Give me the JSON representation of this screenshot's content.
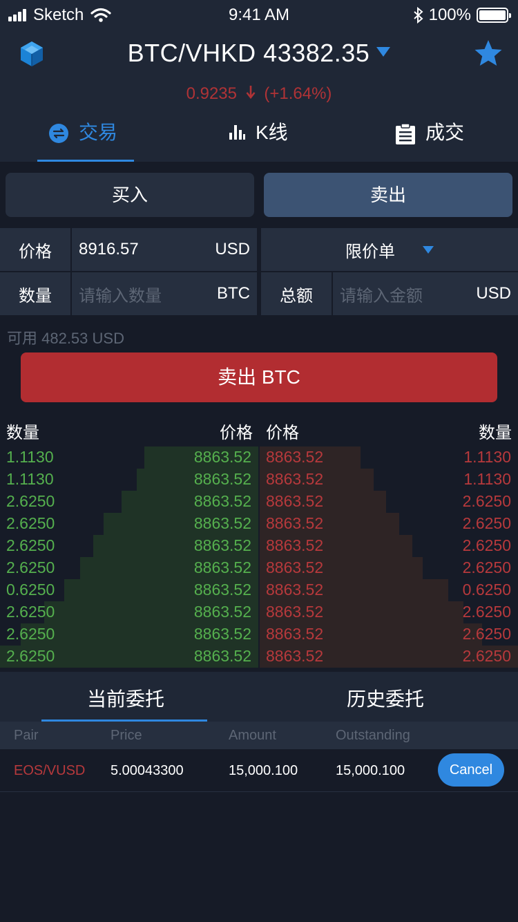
{
  "status_bar": {
    "carrier": "Sketch",
    "time": "9:41 AM",
    "battery": "100%"
  },
  "header": {
    "pair_title": "BTC/VHKD 43382.35",
    "change_value": "0.9235",
    "change_percent": "(+1.64%)",
    "change_color": "#b03336",
    "accent_color": "#2f88e0"
  },
  "tabs": [
    {
      "label": "交易",
      "icon": "exchange-icon"
    },
    {
      "label": "K线",
      "icon": "bar-chart-icon"
    },
    {
      "label": "成交",
      "icon": "clipboard-icon"
    }
  ],
  "trade_toggle": {
    "buy": "买入",
    "sell": "卖出"
  },
  "form": {
    "price_label": "价格",
    "price_value": "8916.57",
    "price_unit": "USD",
    "order_type": "限价单",
    "quantity_label": "数量",
    "quantity_placeholder": "请输入数量",
    "quantity_unit": "BTC",
    "total_label": "总额",
    "total_placeholder": "请输入金额",
    "total_unit": "USD",
    "available": "可用 482.53 USD",
    "submit": "卖出 BTC"
  },
  "order_book": {
    "bid_amount_header": "数量",
    "bid_price_header": "价格",
    "ask_price_header": "价格",
    "ask_amount_header": "数量",
    "bid_color": "#55b04e",
    "ask_color": "#b7393c",
    "rows": [
      {
        "bid_amount": "1.1130",
        "bid_price": "8863.52",
        "ask_price": "8863.52",
        "ask_amount": "1.1130",
        "bid_depth": 0.44,
        "ask_depth": 0.39
      },
      {
        "bid_amount": "1.1130",
        "bid_price": "8863.52",
        "ask_price": "8863.52",
        "ask_amount": "1.1130",
        "bid_depth": 0.47,
        "ask_depth": 0.44
      },
      {
        "bid_amount": "2.6250",
        "bid_price": "8863.52",
        "ask_price": "8863.52",
        "ask_amount": "2.6250",
        "bid_depth": 0.53,
        "ask_depth": 0.49
      },
      {
        "bid_amount": "2.6250",
        "bid_price": "8863.52",
        "ask_price": "8863.52",
        "ask_amount": "2.6250",
        "bid_depth": 0.6,
        "ask_depth": 0.54
      },
      {
        "bid_amount": "2.6250",
        "bid_price": "8863.52",
        "ask_price": "8863.52",
        "ask_amount": "2.6250",
        "bid_depth": 0.64,
        "ask_depth": 0.59
      },
      {
        "bid_amount": "2.6250",
        "bid_price": "8863.52",
        "ask_price": "8863.52",
        "ask_amount": "2.6250",
        "bid_depth": 0.69,
        "ask_depth": 0.63
      },
      {
        "bid_amount": "0.6250",
        "bid_price": "8863.52",
        "ask_price": "8863.52",
        "ask_amount": "0.6250",
        "bid_depth": 0.75,
        "ask_depth": 0.73
      },
      {
        "bid_amount": "2.6250",
        "bid_price": "8863.52",
        "ask_price": "8863.52",
        "ask_amount": "2.6250",
        "bid_depth": 0.83,
        "ask_depth": 0.79
      },
      {
        "bid_amount": "2.6250",
        "bid_price": "8863.52",
        "ask_price": "8863.52",
        "ask_amount": "2.6250",
        "bid_depth": 0.92,
        "ask_depth": 0.86
      },
      {
        "bid_amount": "2.6250",
        "bid_price": "8863.52",
        "ask_price": "8863.52",
        "ask_amount": "2.6250",
        "bid_depth": 1.0,
        "ask_depth": 1.0
      }
    ]
  },
  "orders": {
    "tab_current": "当前委托",
    "tab_history": "历史委托",
    "columns": [
      "Pair",
      "Price",
      "Amount",
      "Outstanding"
    ],
    "rows": [
      {
        "pair": "EOS/VUSD",
        "price": "5.00043300",
        "amount": "15,000.100",
        "outstanding": "15,000.100",
        "action": "Cancel"
      }
    ]
  }
}
